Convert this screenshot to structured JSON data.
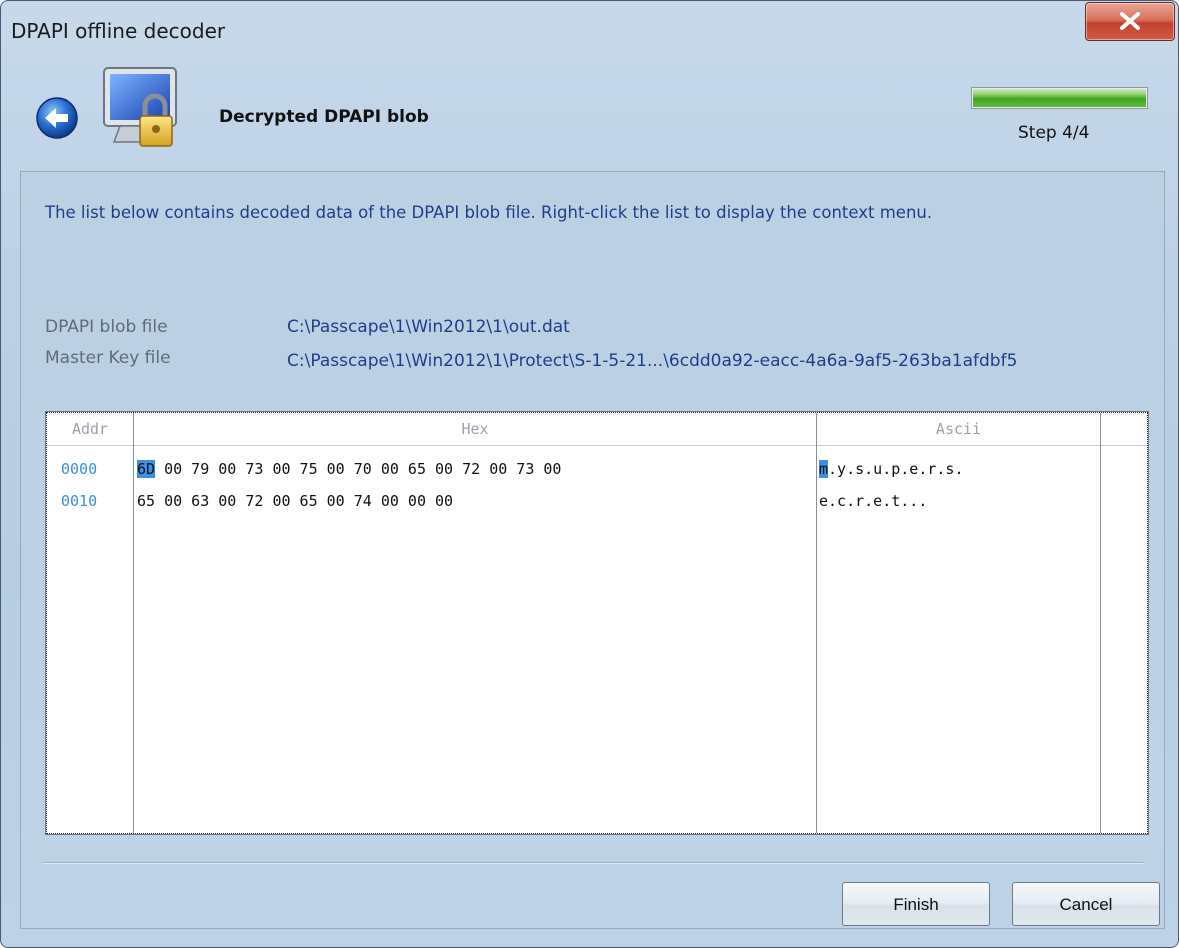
{
  "window": {
    "title": "DPAPI offline decoder"
  },
  "header": {
    "page_title": "Decrypted DPAPI blob",
    "step_label": "Step 4/4",
    "progress": 1.0
  },
  "main": {
    "description": "The list below contains decoded data of the DPAPI blob file. Right-click the list to display the context menu.",
    "fields": [
      {
        "label": "DPAPI blob file",
        "value": "C:\\Passcape\\1\\Win2012\\1\\out.dat"
      },
      {
        "label": "Master Key file",
        "value": "C:\\Passcape\\1\\Win2012\\1\\Protect\\S-1-5-21...\\6cdd0a92-eacc-4a6a-9af5-263ba1afdbf5"
      }
    ],
    "hexview": {
      "columns": [
        "Addr",
        "Hex",
        "Ascii"
      ],
      "rows": [
        {
          "addr": "0000",
          "hex_first": "6D",
          "hex_rest": " 00 79 00 73 00 75 00 70 00 65 00 72 00 73 00",
          "ascii_first": "m",
          "ascii_rest": ".y.s.u.p.e.r.s."
        },
        {
          "addr": "0010",
          "hex_first": "",
          "hex_rest": "65 00 63 00 72 00 65 00 74 00 00 00",
          "ascii_first": "",
          "ascii_rest": "e.c.r.e.t..."
        }
      ]
    }
  },
  "buttons": {
    "finish": "Finish",
    "cancel": "Cancel"
  },
  "icons": {
    "close": "close-icon",
    "back": "back-arrow-icon",
    "app": "monitor-lock-icon"
  }
}
